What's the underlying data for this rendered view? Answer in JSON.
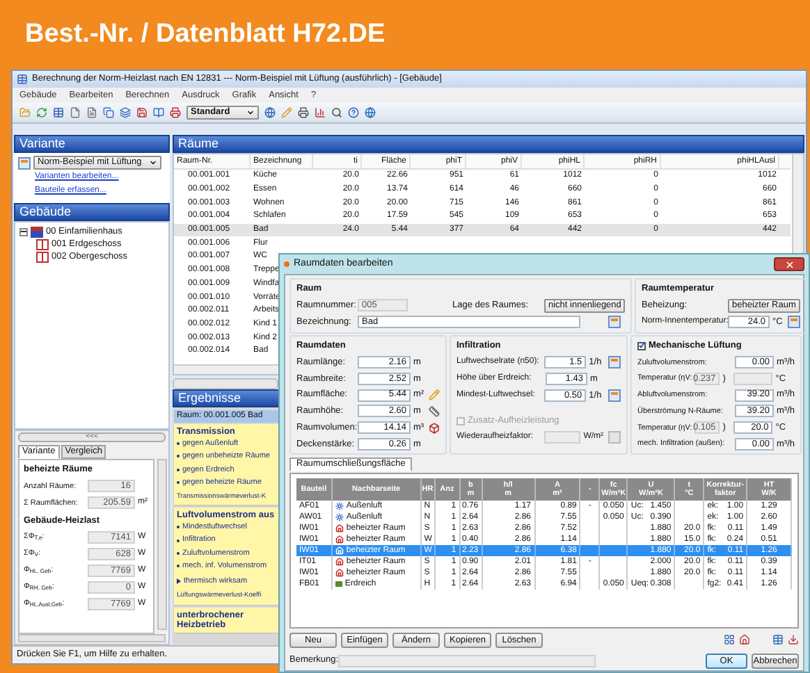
{
  "banner": {
    "title": "Best.-Nr. / Datenblatt H72.DE"
  },
  "window": {
    "title": "Berechnung der Norm-Heizlast nach EN 12831 --- Norm-Beispiel mit Lüftung (ausführlich) - [Gebäude]",
    "menu": [
      "Gebäude",
      "Bearbeiten",
      "Berechnen",
      "Ausdruck",
      "Grafik",
      "Ansicht",
      "?"
    ],
    "style_select": "Standard"
  },
  "variant": {
    "header": "Variante",
    "select": "Norm-Beispiel mit Lüftung",
    "links": [
      "Varianten bearbeiten...",
      "Bauteile erfassen..."
    ]
  },
  "building": {
    "header": "Gebäude",
    "tree": [
      {
        "label": "00 Einfamilienhaus",
        "expanded": true,
        "children": [
          {
            "label": "001 Erdgeschoss"
          },
          {
            "label": "002 Obergeschoss"
          }
        ]
      }
    ]
  },
  "summary": {
    "collapse": "<<<",
    "tabs": [
      {
        "label": "Variante",
        "selected": true
      },
      {
        "label": "Vergleich",
        "selected": false
      }
    ],
    "groups": [
      {
        "title": "beheizte Räume",
        "rows": [
          {
            "label": "Anzahl Räume:",
            "value": "16"
          },
          {
            "label": "Σ Raumflächen:",
            "value": "205.59",
            "unit": "m²"
          }
        ]
      },
      {
        "title": "Gebäude-Heizlast",
        "rows": [
          {
            "label": "ΣΦ$_{T,e}$:",
            "value": "7141",
            "unit": "W"
          },
          {
            "label": "ΣΦ$_{V}$:",
            "value": "628",
            "unit": "W"
          },
          {
            "label": "Φ$_{HL, Geb}$:",
            "value": "7769",
            "unit": "W"
          },
          {
            "label": "Φ$_{RH, Geb}$:",
            "value": "0",
            "unit": "W"
          },
          {
            "label": "Φ$_{HL,Ausl,Geb}$:",
            "value": "7769",
            "unit": "W"
          }
        ]
      }
    ]
  },
  "rooms": {
    "header": "Räume",
    "columns": [
      "Raum-Nr.",
      "Bezeichnung",
      "ti",
      "Fläche",
      "phiT",
      "phiV",
      "phiHL",
      "phiRH",
      "phiHLAusl"
    ],
    "rows": [
      {
        "cells": [
          "00.001.001",
          "Küche",
          "20.0",
          "22.66",
          "951",
          "61",
          "1012",
          "0",
          "1012"
        ],
        "selected": false
      },
      {
        "cells": [
          "00.001.002",
          "Essen",
          "20.0",
          "13.74",
          "614",
          "46",
          "660",
          "0",
          "660"
        ],
        "selected": false
      },
      {
        "cells": [
          "00.001.003",
          "Wohnen",
          "20.0",
          "20.00",
          "715",
          "146",
          "861",
          "0",
          "861"
        ],
        "selected": false
      },
      {
        "cells": [
          "00.001.004",
          "Schlafen",
          "20.0",
          "17.59",
          "545",
          "109",
          "653",
          "0",
          "653"
        ],
        "selected": false
      },
      {
        "cells": [
          "00.001.005",
          "Bad",
          "24.0",
          "5.44",
          "377",
          "64",
          "442",
          "0",
          "442"
        ],
        "selected": true
      },
      {
        "cells": [
          "00.001.006",
          "Flur"
        ],
        "selected": false
      },
      {
        "cells": [
          "00.001.007",
          "WC"
        ],
        "selected": false
      },
      {
        "cells": [
          "00.001.008",
          "Treppe"
        ],
        "selected": false
      },
      {
        "cells": [
          "00.001.009",
          "Windfa"
        ],
        "selected": false
      },
      {
        "cells": [
          "00.001.010",
          "Vorräte"
        ],
        "selected": false
      },
      {
        "cells": [
          "00.002.011",
          "Arbeits"
        ],
        "selected": false
      },
      {
        "cells": [
          "00.002.012",
          "Kind 1"
        ],
        "selected": false
      },
      {
        "cells": [
          "00.002.013",
          "Kind 2"
        ],
        "selected": false
      },
      {
        "cells": [
          "00.002.014",
          "Bad"
        ],
        "selected": false
      }
    ]
  },
  "results": {
    "header": "Ergebnisse",
    "room": "Raum: 00.001.005 Bad",
    "sections": [
      {
        "title": "Transmission",
        "items": [
          {
            "kind": "bullet",
            "text": "gegen Außenluft"
          },
          {
            "kind": "bullet",
            "text": "gegen unbeheizte Räume"
          },
          {
            "kind": "bullet",
            "text": "gegen Erdreich"
          },
          {
            "kind": "bullet",
            "text": "gegen beheizte Räume"
          },
          {
            "kind": "plain",
            "text": "Transmissionswärmeverlust-K"
          }
        ]
      },
      {
        "title": "Luftvolumenstrom aus",
        "items": [
          {
            "kind": "bullet",
            "text": "Mindestluftwechsel"
          },
          {
            "kind": "bullet",
            "text": "Infiltration"
          },
          {
            "kind": "bullet",
            "text": "Zuluftvolumenstrom"
          },
          {
            "kind": "bullet",
            "text": "mech. inf. Volumenstrom"
          },
          {
            "kind": "arrow",
            "text": "thermisch wirksam"
          },
          {
            "kind": "plain",
            "text": "Lüftungswärmeverlust-Koeffi"
          }
        ]
      },
      {
        "title": "unterbrochener Heizbetrieb"
      }
    ]
  },
  "status_bar": "Drücken Sie F1, um Hilfe zu erhalten.",
  "dialog": {
    "title": "Raumdaten bearbeiten",
    "room_group": {
      "title": "Raum",
      "number_label": "Raumnummer:",
      "number": "005",
      "position_label": "Lage des Raumes:",
      "position": "nicht innenliegend",
      "name_label": "Bezeichnung:",
      "name": "Bad"
    },
    "temp_group": {
      "title": "Raumtemperatur",
      "heating_label": "Beheizung:",
      "heating": "beheizter Raum",
      "temp_label": "Norm-Innentemperatur:",
      "temp": "24.0",
      "temp_unit": "°C"
    },
    "dims_group": {
      "title": "Raumdaten",
      "rows": [
        {
          "kind": "field",
          "label": "Raumlänge:",
          "value": "2.16",
          "unit": "m"
        },
        {
          "kind": "field",
          "label": "Raumbreite:",
          "value": "2.52",
          "unit": "m"
        },
        {
          "kind": "tool",
          "label": "Raumfläche:",
          "value": "5.44",
          "unit": "m²"
        },
        {
          "kind": "tool",
          "label": "Raumhöhe:",
          "value": "2.60",
          "unit": "m"
        },
        {
          "kind": "tool",
          "label": "Raumvolumen:",
          "value": "14.14",
          "unit": "m³"
        },
        {
          "kind": "field",
          "label": "Deckenstärke:",
          "value": "0.26",
          "unit": "m"
        }
      ]
    },
    "infiltration_group": {
      "title": "Infiltration",
      "rows": [
        {
          "kind": "form",
          "label": "Luftwechselrate (n50):",
          "value": "1.5",
          "unit": "1/h"
        },
        {
          "kind": "field",
          "label": "Höhe über Erdreich:",
          "value": "1.43",
          "unit": "m"
        },
        {
          "kind": "form",
          "label": "Mindest-Luftwechsel:",
          "value": "0.50",
          "unit": "1/h"
        }
      ],
      "extra": {
        "label": "Zusatz-Aufheizleistung",
        "checked": false,
        "disabled": true
      },
      "factor": {
        "label": "Wiederaufheizfaktor:",
        "unit": "W/m²",
        "disabled": true
      }
    },
    "ventilation_group": {
      "title": "Mechanische Lüftung",
      "checked": true,
      "rows": [
        {
          "kind": "field",
          "label": "Zuluftvolumenstrom:",
          "value": "0.00",
          "unit": "m³/h"
        },
        {
          "kind": "eta",
          "label": "Temperatur (ηV:",
          "eta": "0.237",
          "close": ")",
          "value": "",
          "disabled": true,
          "unit": "°C"
        },
        {
          "kind": "field",
          "label": "Abluftvolumenstrom:",
          "value": "39.20",
          "unit": "m³/h"
        },
        {
          "kind": "field",
          "label": "Überströmung N-Räume:",
          "value": "39.20",
          "unit": "m³/h"
        },
        {
          "kind": "eta",
          "label": "Temperatur (ηV:",
          "eta": "0.105",
          "close": ")",
          "value": "20.0",
          "disabled": false,
          "unit": "°C"
        },
        {
          "kind": "field",
          "label": "mech. Infiltration (außen):",
          "value": "0.00",
          "unit": "m³/h"
        }
      ]
    },
    "tabs": [
      {
        "label": "Raumumschließungsfläche",
        "selected": true
      }
    ],
    "surfaces": {
      "columns": [
        [
          "Bauteil"
        ],
        [
          "Nachbarseite"
        ],
        [
          "HR"
        ],
        [
          "Anz"
        ],
        [
          "b",
          "m"
        ],
        [
          "h/l",
          "m"
        ],
        [
          "A",
          "m²"
        ],
        [
          "-"
        ],
        [
          "fc",
          "W/m²K"
        ],
        [
          "U",
          "W/m²K"
        ],
        [
          "t",
          "°C"
        ],
        [
          "Korrektur-",
          "faktor"
        ],
        [
          "HT",
          "W/K"
        ]
      ],
      "rows": [
        {
          "part": "AF01",
          "side": "Außenluft",
          "kind": "outside",
          "dir": "N",
          "count": "1",
          "b": "0.76",
          "h": "1.17",
          "a": "0.89",
          "dash": "-",
          "fc": "0.050",
          "u_label": "Uc:",
          "u": "1.450",
          "t": "",
          "f_label": "ek:",
          "f": "1.00",
          "ht": "1.29",
          "selected": false
        },
        {
          "part": "AW01",
          "side": "Außenluft",
          "kind": "outside",
          "dir": "N",
          "count": "1",
          "b": "2.64",
          "h": "2.86",
          "a": "7.55",
          "dash": "",
          "fc": "0.050",
          "u_label": "Uc:",
          "u": "0.390",
          "t": "",
          "f_label": "ek:",
          "f": "1.00",
          "ht": "2.60",
          "selected": false
        },
        {
          "part": "IW01",
          "side": "beheizter Raum",
          "kind": "heated",
          "dir": "S",
          "count": "1",
          "b": "2.63",
          "h": "2.86",
          "a": "7.52",
          "dash": "",
          "fc": "",
          "u_label": "",
          "u": "1.880",
          "t": "20.0",
          "f_label": "fk:",
          "f": "0.11",
          "ht": "1.49",
          "selected": false
        },
        {
          "part": "IW01",
          "side": "beheizter Raum",
          "kind": "heated",
          "dir": "W",
          "count": "1",
          "b": "0.40",
          "h": "2.86",
          "a": "1.14",
          "dash": "",
          "fc": "",
          "u_label": "",
          "u": "1.880",
          "t": "15.0",
          "f_label": "fk:",
          "f": "0.24",
          "ht": "0.51",
          "selected": false
        },
        {
          "part": "IW01",
          "side": "beheizter Raum",
          "kind": "heated",
          "dir": "W",
          "count": "1",
          "b": "2.23",
          "h": "2.86",
          "a": "6.38",
          "dash": "",
          "fc": "",
          "u_label": "",
          "u": "1.880",
          "t": "20.0",
          "f_label": "fk:",
          "f": "0.11",
          "ht": "1.26",
          "selected": true
        },
        {
          "part": "IT01",
          "side": "beheizter Raum",
          "kind": "heated",
          "dir": "S",
          "count": "1",
          "b": "0.90",
          "h": "2.01",
          "a": "1.81",
          "dash": "-",
          "fc": "",
          "u_label": "",
          "u": "2.000",
          "t": "20.0",
          "f_label": "fk:",
          "f": "0.11",
          "ht": "0.39",
          "selected": false
        },
        {
          "part": "IW01",
          "side": "beheizter Raum",
          "kind": "heated",
          "dir": "S",
          "count": "1",
          "b": "2.64",
          "h": "2.86",
          "a": "7.55",
          "dash": "",
          "fc": "",
          "u_label": "",
          "u": "1.880",
          "t": "20.0",
          "f_label": "fk:",
          "f": "0.11",
          "ht": "1.14",
          "selected": false
        },
        {
          "part": "FB01",
          "side": "Erdreich",
          "kind": "ground",
          "dir": "H",
          "count": "1",
          "b": "2.64",
          "h": "2.63",
          "a": "6.94",
          "dash": "",
          "fc": "0.050",
          "u_label": "Ueq:",
          "u": "0.308",
          "t": "",
          "f_label": "fg2:",
          "f": "0.41",
          "ht": "1.26",
          "selected": false
        }
      ]
    },
    "buttons": [
      "Neu",
      "Einfügen",
      "Ändern",
      "Kopieren",
      "Löschen"
    ],
    "remark_label": "Bemerkung:",
    "ok": "OK",
    "cancel": "Abbrechen"
  }
}
